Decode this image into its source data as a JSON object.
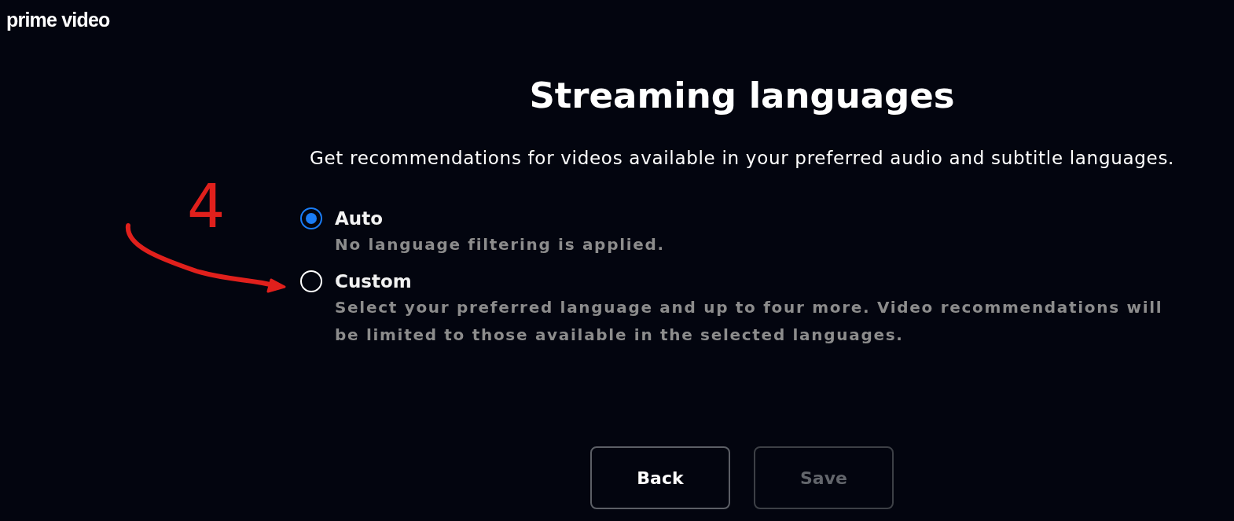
{
  "logo": {
    "text": "prime video"
  },
  "page": {
    "title": "Streaming languages",
    "subtitle": "Get recommendations for videos available in your preferred audio and subtitle languages."
  },
  "options": [
    {
      "label": "Auto",
      "description": "No language filtering is applied.",
      "selected": true
    },
    {
      "label": "Custom",
      "description": "Select your preferred language and up to four more. Video recommendations will be limited to those available in the selected languages.",
      "selected": false
    }
  ],
  "buttons": [
    {
      "label": "Back",
      "disabled": false
    },
    {
      "label": "Save",
      "disabled": true
    }
  ],
  "annotation": {
    "label": "4"
  }
}
